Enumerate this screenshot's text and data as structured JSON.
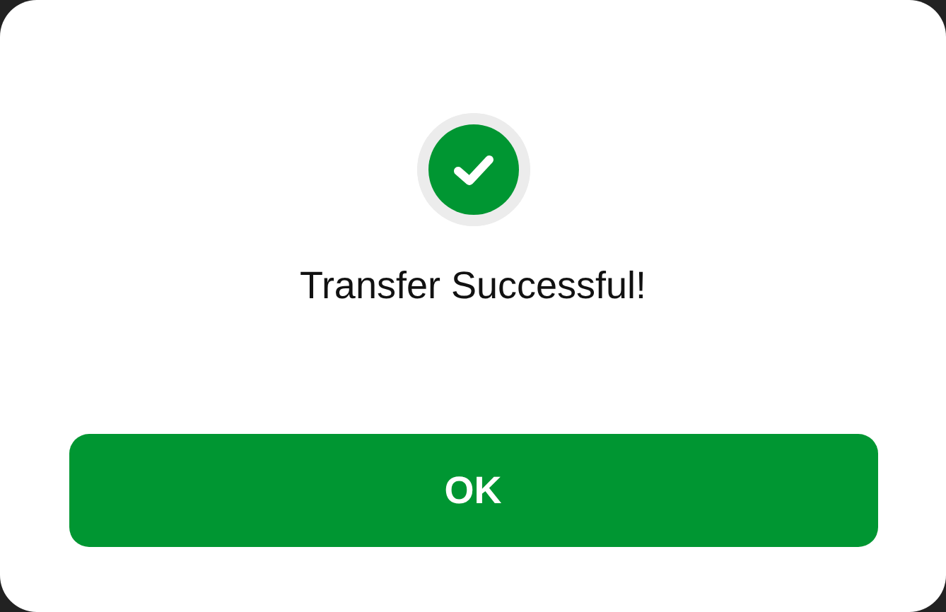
{
  "dialog": {
    "title": "Transfer Successful!",
    "button": "OK"
  }
}
